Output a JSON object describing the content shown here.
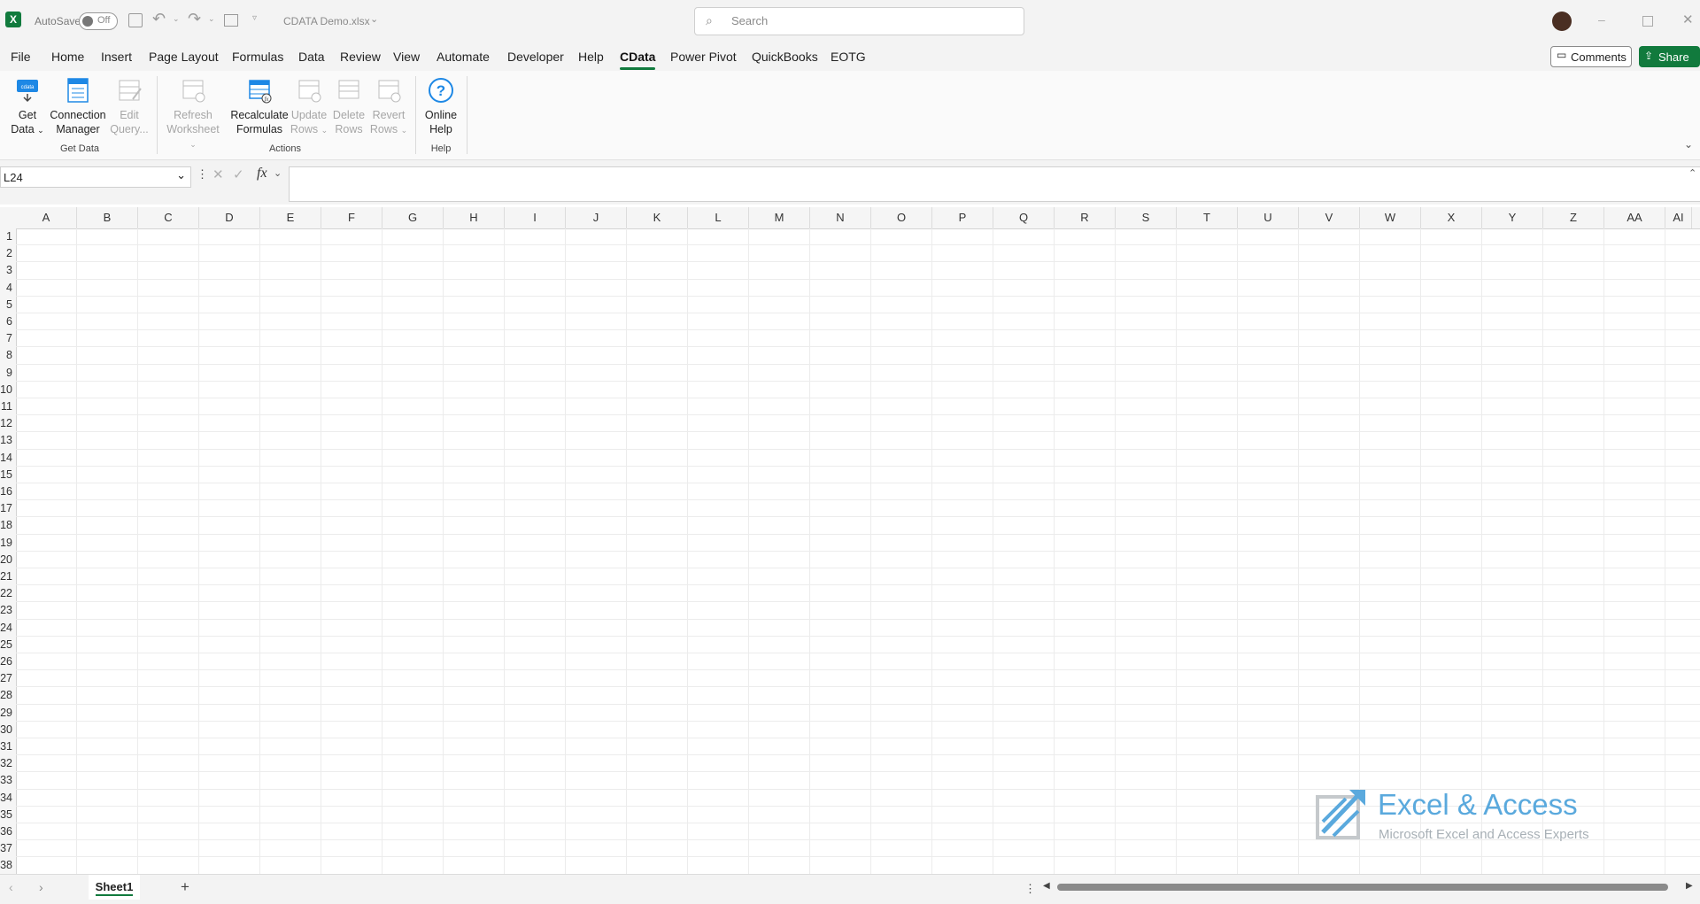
{
  "titlebar": {
    "autosave_label": "AutoSave",
    "autosave_state": "Off",
    "filename": "CDATA Demo.xlsx",
    "search_placeholder": "Search"
  },
  "ribbon_tabs": [
    "File",
    "Home",
    "Insert",
    "Page Layout",
    "Formulas",
    "Data",
    "Review",
    "View",
    "Automate",
    "Developer",
    "Help",
    "CData",
    "Power Pivot",
    "QuickBooks",
    "EOTG"
  ],
  "active_tab": "CData",
  "comments_label": "Comments",
  "share_label": "Share",
  "ribbon": {
    "get_data": [
      "Get",
      "Data"
    ],
    "connection_manager": [
      "Connection",
      "Manager"
    ],
    "edit_query": [
      "Edit",
      "Query..."
    ],
    "group_get_data": "Get Data",
    "refresh": [
      "Refresh",
      "Worksheet"
    ],
    "recalculate": [
      "Recalculate",
      "Formulas"
    ],
    "update_rows": [
      "Update",
      "Rows"
    ],
    "delete_rows": [
      "Delete",
      "Rows"
    ],
    "revert_rows": [
      "Revert",
      "Rows"
    ],
    "group_actions": "Actions",
    "online_help": [
      "Online",
      "Help"
    ],
    "group_help": "Help"
  },
  "formula_bar": {
    "name_box": "L24",
    "fx": "fx",
    "formula": ""
  },
  "columns": [
    "A",
    "B",
    "C",
    "D",
    "E",
    "F",
    "G",
    "H",
    "I",
    "J",
    "K",
    "L",
    "M",
    "N",
    "O",
    "P",
    "Q",
    "R",
    "S",
    "T",
    "U",
    "V",
    "W",
    "X",
    "Y",
    "Z",
    "AA",
    "AI"
  ],
  "rows": [
    "1",
    "2",
    "3",
    "4",
    "5",
    "6",
    "7",
    "8",
    "9",
    "10",
    "11",
    "12",
    "13",
    "14",
    "15",
    "16",
    "17",
    "18",
    "19",
    "20",
    "21",
    "22",
    "23",
    "24",
    "25",
    "26",
    "27",
    "28",
    "29",
    "30",
    "31",
    "32",
    "33",
    "34",
    "35",
    "36",
    "37",
    "38"
  ],
  "sheet_tab": "Sheet1",
  "watermark": {
    "title": "Excel & Access",
    "subtitle": "Microsoft Excel and Access Experts"
  },
  "colors": {
    "excel_green": "#117a3d",
    "cdata_blue": "#1e88e5",
    "watermark_blue": "#5aa9dd"
  }
}
